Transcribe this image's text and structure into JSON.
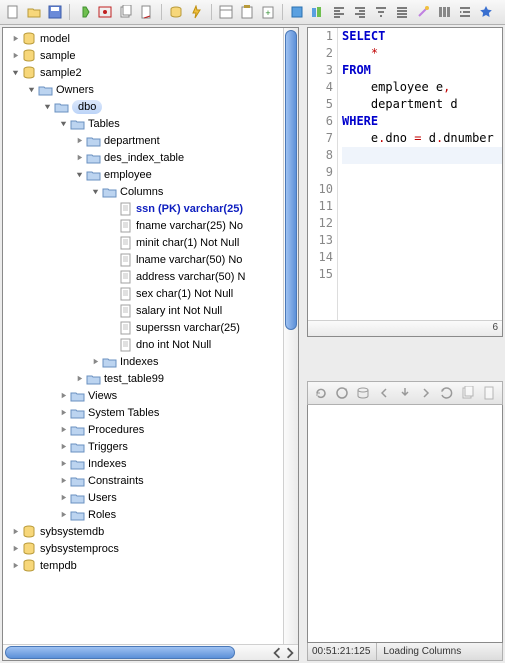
{
  "toolbar_icons": [
    "new",
    "open",
    "save",
    "sep",
    "exec",
    "run-sel",
    "copy",
    "cut",
    "sep",
    "bookmark",
    "flash",
    "sep",
    "props",
    "paste-script",
    "paste-plus",
    "sep",
    "book",
    "books",
    "align-left",
    "align-right",
    "filter",
    "align-fill",
    "magic",
    "columns",
    "indent",
    "star"
  ],
  "tree": [
    {
      "depth": 0,
      "expand": "closed",
      "icon": "db",
      "label": "model"
    },
    {
      "depth": 0,
      "expand": "closed",
      "icon": "db",
      "label": "sample"
    },
    {
      "depth": 0,
      "expand": "open",
      "icon": "db",
      "label": "sample2"
    },
    {
      "depth": 1,
      "expand": "open",
      "icon": "folder",
      "label": "Owners"
    },
    {
      "depth": 2,
      "expand": "open",
      "icon": "folder",
      "label": "dbo",
      "highlight": true
    },
    {
      "depth": 3,
      "expand": "open",
      "icon": "folder",
      "label": "Tables"
    },
    {
      "depth": 4,
      "expand": "closed",
      "icon": "folder",
      "label": "department"
    },
    {
      "depth": 4,
      "expand": "closed",
      "icon": "folder",
      "label": "des_index_table"
    },
    {
      "depth": 4,
      "expand": "open",
      "icon": "folder",
      "label": "employee"
    },
    {
      "depth": 5,
      "expand": "open",
      "icon": "folder",
      "label": "Columns"
    },
    {
      "depth": 6,
      "expand": "none",
      "icon": "file",
      "label": "ssn (PK) varchar(25)",
      "bold": true
    },
    {
      "depth": 6,
      "expand": "none",
      "icon": "file",
      "label": "fname varchar(25) No"
    },
    {
      "depth": 6,
      "expand": "none",
      "icon": "file",
      "label": "minit char(1) Not Null"
    },
    {
      "depth": 6,
      "expand": "none",
      "icon": "file",
      "label": "lname varchar(50) No"
    },
    {
      "depth": 6,
      "expand": "none",
      "icon": "file",
      "label": "address varchar(50) N"
    },
    {
      "depth": 6,
      "expand": "none",
      "icon": "file",
      "label": "sex char(1) Not Null"
    },
    {
      "depth": 6,
      "expand": "none",
      "icon": "file",
      "label": "salary int Not Null"
    },
    {
      "depth": 6,
      "expand": "none",
      "icon": "file",
      "label": "superssn varchar(25)"
    },
    {
      "depth": 6,
      "expand": "none",
      "icon": "file",
      "label": "dno int Not Null"
    },
    {
      "depth": 5,
      "expand": "closed",
      "icon": "folder",
      "label": "Indexes"
    },
    {
      "depth": 4,
      "expand": "closed",
      "icon": "folder",
      "label": "test_table99"
    },
    {
      "depth": 3,
      "expand": "closed",
      "icon": "folder",
      "label": "Views"
    },
    {
      "depth": 3,
      "expand": "closed",
      "icon": "folder",
      "label": "System Tables"
    },
    {
      "depth": 3,
      "expand": "closed",
      "icon": "folder",
      "label": "Procedures"
    },
    {
      "depth": 3,
      "expand": "closed",
      "icon": "folder",
      "label": "Triggers"
    },
    {
      "depth": 3,
      "expand": "closed",
      "icon": "folder",
      "label": "Indexes"
    },
    {
      "depth": 3,
      "expand": "closed",
      "icon": "folder",
      "label": "Constraints"
    },
    {
      "depth": 3,
      "expand": "closed",
      "icon": "folder",
      "label": "Users"
    },
    {
      "depth": 3,
      "expand": "closed",
      "icon": "folder",
      "label": "Roles"
    },
    {
      "depth": 0,
      "expand": "closed",
      "icon": "db",
      "label": "sybsystemdb"
    },
    {
      "depth": 0,
      "expand": "closed",
      "icon": "db",
      "label": "sybsystemprocs"
    },
    {
      "depth": 0,
      "expand": "closed",
      "icon": "db",
      "label": "tempdb"
    }
  ],
  "editor": {
    "numbered_lines": 15,
    "lines": [
      {
        "tokens": [
          {
            "t": "SELECT",
            "c": "kw"
          }
        ]
      },
      {
        "tokens": [
          {
            "t": "    "
          },
          {
            "t": "*",
            "c": "op"
          }
        ]
      },
      {
        "tokens": [
          {
            "t": "FROM",
            "c": "kw"
          }
        ]
      },
      {
        "tokens": [
          {
            "t": "    employee e"
          },
          {
            "t": ",",
            "c": "op"
          }
        ]
      },
      {
        "tokens": [
          {
            "t": "    department d"
          }
        ]
      },
      {
        "tokens": [
          {
            "t": "WHERE",
            "c": "kw"
          }
        ]
      },
      {
        "tokens": [
          {
            "t": "    e"
          },
          {
            "t": ".",
            "c": "op"
          },
          {
            "t": "dno "
          },
          {
            "t": "=",
            "c": "op"
          },
          {
            "t": " d"
          },
          {
            "t": ".",
            "c": "op"
          },
          {
            "t": "dnumber"
          }
        ]
      },
      {
        "tokens": [],
        "current": true
      }
    ],
    "hscroll_count": "6"
  },
  "second_toolbar_icons": [
    "refresh",
    "rerun",
    "db-icon",
    "arrow-left",
    "arrow-in",
    "arrow-right",
    "undo",
    "copy",
    "page"
  ],
  "status": {
    "time": "00:51:21:125",
    "text": "Loading Columns"
  }
}
